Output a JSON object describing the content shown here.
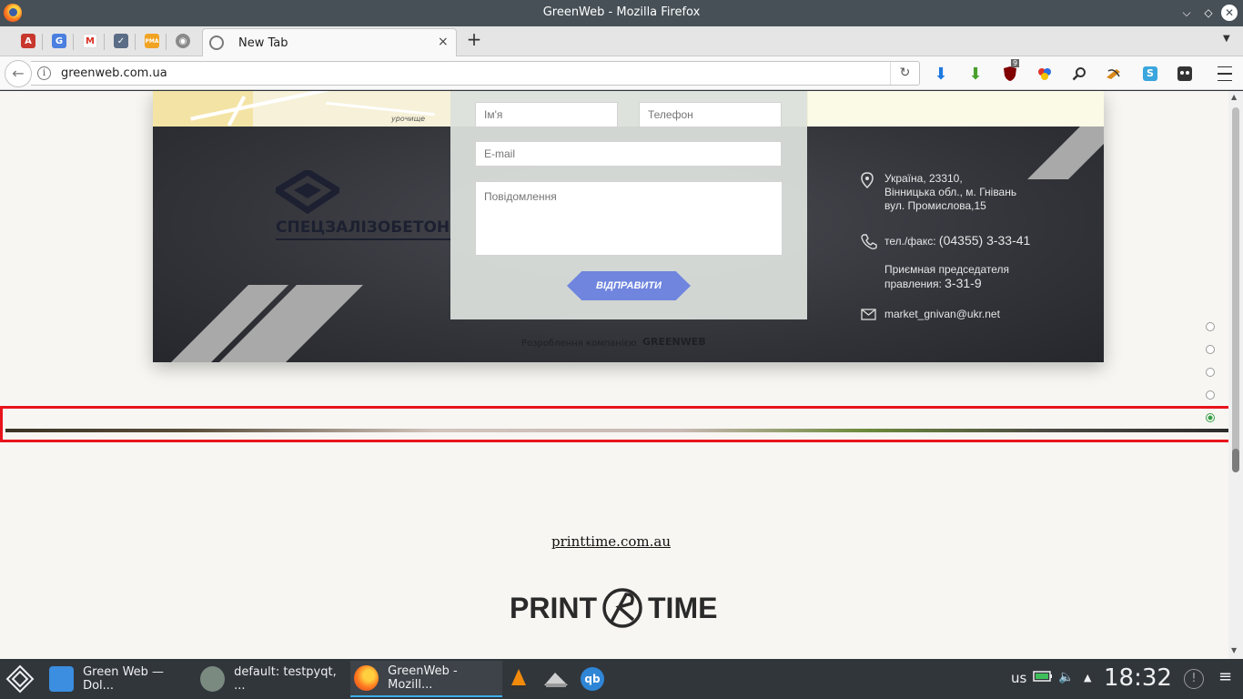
{
  "window": {
    "title": "GreenWeb - Mozilla Firefox",
    "min_glyph": "⌵",
    "max_glyph": "◇",
    "close_glyph": "✕"
  },
  "tabs": {
    "pinned": [
      {
        "name": "pinned-tab-abp",
        "glyph": "A",
        "color": "#c8372d"
      },
      {
        "name": "pinned-tab-translate",
        "glyph": "G",
        "color": "#4a7fe0"
      },
      {
        "name": "pinned-tab-gmail",
        "glyph": "M",
        "color": "#ffffff",
        "text_color": "#d93025"
      },
      {
        "name": "pinned-tab-mail",
        "glyph": "✓",
        "color": "#5a6c86"
      },
      {
        "name": "pinned-tab-pma",
        "glyph": "PMA",
        "color": "#f1a323"
      },
      {
        "name": "pinned-tab-globe",
        "glyph": "◉",
        "color": "#8a8a8a"
      }
    ],
    "active_label": "New Tab",
    "close_glyph": "×",
    "new_tab_glyph": "+",
    "list_glyph": "▼"
  },
  "navbar": {
    "back_glyph": "←",
    "info_glyph": "i",
    "url": "greenweb.com.ua",
    "reload_glyph": "↻",
    "ublock_badge": "9"
  },
  "map": {
    "label": "урочище"
  },
  "form": {
    "name_placeholder": "Ім'я",
    "phone_placeholder": "Телефон",
    "email_placeholder": "E-mail",
    "message_placeholder": "Повідомлення",
    "send_label": "ВІДПРАВИТИ"
  },
  "company": {
    "logo_text": "СПЕЦЗАЛІЗОБЕТОН"
  },
  "contacts": {
    "address_line1": "Україна, 23310,",
    "address_line2": "Вінницька обл., м. Гнівань",
    "address_line3": "вул. Промислова,15",
    "phone_label": "тел./факс:",
    "phone_number": "(04355) 3-33-41",
    "reception_line1": "Приємная председателя",
    "reception_line2_label": "правления:",
    "reception_number": "3-31-9",
    "email": "market_gnivan@ukr.net"
  },
  "credit": {
    "text": "Розроблення компанією",
    "logo": "GREENWEB"
  },
  "side_nav": {
    "count": 5,
    "active_index": 4
  },
  "printtime": {
    "link": "printtime.com.au",
    "logo_left": "PRINT",
    "logo_right": "TIME"
  },
  "scrollbar": {
    "up_glyph": "▲",
    "down_glyph": "▼"
  },
  "taskbar": {
    "tasks": [
      {
        "label": "Green Web — Dol...",
        "icon": "folder-icon"
      },
      {
        "label": "default:  testpyqt, ...",
        "icon": "gear-icon"
      },
      {
        "label": "GreenWeb - Mozill...",
        "icon": "firefox-icon"
      }
    ],
    "keyboard": "us",
    "clock": "18:32",
    "notify_glyph": "!",
    "tray_up_glyph": "▲",
    "volume_glyph": "🔈",
    "menu_glyph": "≡"
  },
  "colors": {
    "accent": "#3daee9",
    "send_button": "#6f85de",
    "highlight": "#e8131b",
    "active_dot": "#3a9d45"
  }
}
